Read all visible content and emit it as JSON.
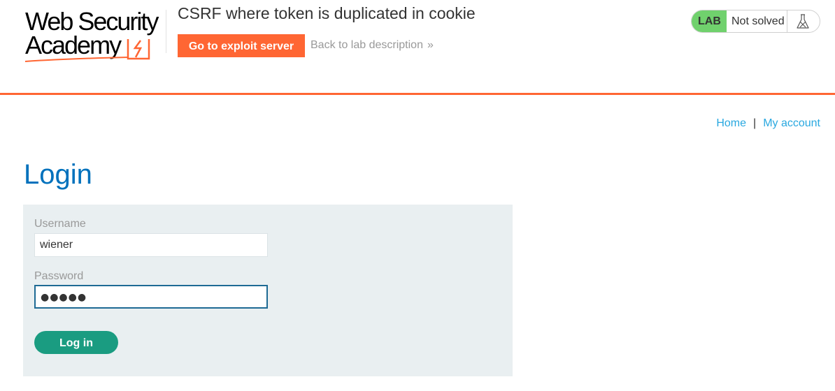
{
  "header": {
    "logo_line1": "Web Security",
    "logo_line2": "Academy",
    "lab_title": "CSRF where token is duplicated in cookie",
    "exploit_button": "Go to exploit server",
    "back_link": "Back to lab description",
    "back_chevron": "»"
  },
  "lab_status": {
    "badge": "LAB",
    "state": "Not solved"
  },
  "nav": {
    "home": "Home",
    "separator": "|",
    "account": "My account"
  },
  "page": {
    "title": "Login"
  },
  "form": {
    "username_label": "Username",
    "username_value": "wiener",
    "password_label": "Password",
    "password_value": "●●●●●",
    "submit_label": "Log in"
  },
  "colors": {
    "accent": "#ff6633",
    "title_blue": "#0071bc",
    "link_blue": "#29a8e0",
    "lab_green": "#70d16d",
    "button_green": "#1a9c81",
    "panel_bg": "#e9eff1"
  },
  "icons": {
    "logo": "web-security-academy-logo",
    "flask": "flask-icon",
    "chevron": "double-chevron-right-icon"
  }
}
